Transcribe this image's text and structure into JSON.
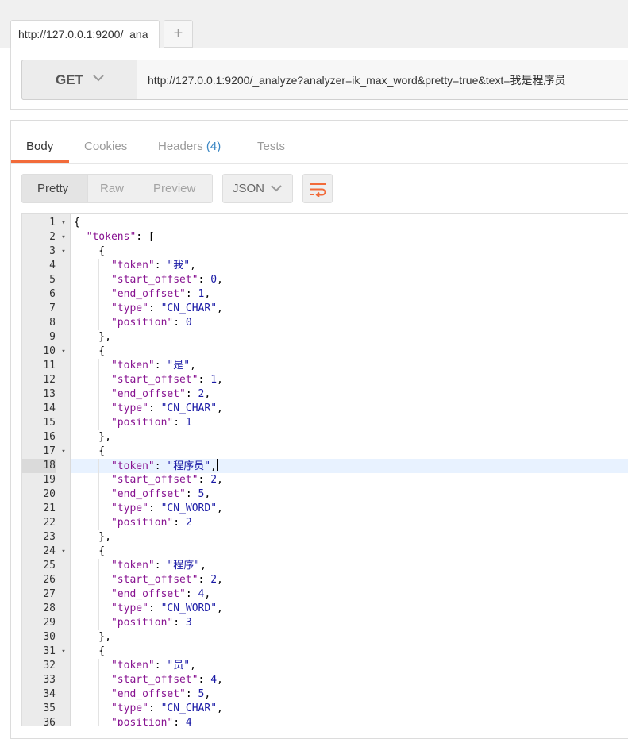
{
  "request_tab": {
    "title": "http://127.0.0.1:9200/_ana",
    "add_label": "+"
  },
  "request": {
    "method": "GET",
    "url": "http://127.0.0.1:9200/_analyze?analyzer=ik_max_word&pretty=true&text=我是程序员"
  },
  "response_tabs": [
    {
      "label": "Body",
      "active": true
    },
    {
      "label": "Cookies",
      "active": false
    },
    {
      "label": "Headers",
      "count": "(4)",
      "active": false
    },
    {
      "label": "Tests",
      "active": false
    }
  ],
  "view_modes": [
    "Pretty",
    "Raw",
    "Preview"
  ],
  "selected_view": "Pretty",
  "language": "JSON",
  "wrap_icon": "wrap-lines-icon",
  "accent_color": "#f26b3a",
  "highlighted_line": 18,
  "code_lines": [
    "{",
    "  \"tokens\": [",
    "    {",
    "      \"token\": \"我\",",
    "      \"start_offset\": 0,",
    "      \"end_offset\": 1,",
    "      \"type\": \"CN_CHAR\",",
    "      \"position\": 0",
    "    },",
    "    {",
    "      \"token\": \"是\",",
    "      \"start_offset\": 1,",
    "      \"end_offset\": 2,",
    "      \"type\": \"CN_CHAR\",",
    "      \"position\": 1",
    "    },",
    "    {",
    "      \"token\": \"程序员\",",
    "      \"start_offset\": 2,",
    "      \"end_offset\": 5,",
    "      \"type\": \"CN_WORD\",",
    "      \"position\": 2",
    "    },",
    "    {",
    "      \"token\": \"程序\",",
    "      \"start_offset\": 2,",
    "      \"end_offset\": 4,",
    "      \"type\": \"CN_WORD\",",
    "      \"position\": 3",
    "    },",
    "    {",
    "      \"token\": \"员\",",
    "      \"start_offset\": 4,",
    "      \"end_offset\": 5,",
    "      \"type\": \"CN_CHAR\",",
    "      \"position\": 4"
  ],
  "foldable_lines": [
    1,
    2,
    3,
    10,
    17,
    24,
    31
  ]
}
